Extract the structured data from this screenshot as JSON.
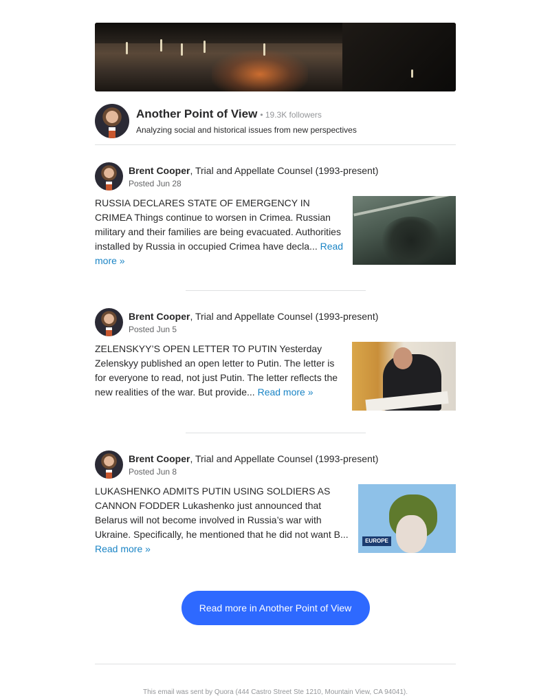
{
  "space": {
    "name": "Another Point of View",
    "followers": "• 19.3K followers",
    "description": "Analyzing social and historical issues from new perspectives"
  },
  "posts": [
    {
      "author": "Brent Cooper",
      "credential": ", Trial and Appellate Counsel (1993-present)",
      "date": "Posted Jun 28",
      "excerpt": "RUSSIA DECLARES STATE OF EMERGENCY IN CRIMEA Things continue to worsen in Crimea. Russian military and their families are being evacuated. Authorities installed by Russia in occupied Crimea have decla...",
      "read_more": "Read more »"
    },
    {
      "author": "Brent Cooper",
      "credential": ", Trial and Appellate Counsel (1993-present)",
      "date": "Posted Jun 5",
      "excerpt": "ZELENSKYY’S OPEN LETTER TO PUTIN Yesterday Zelenskyy published an open letter to Putin. The letter is for everyone to read, not just Putin. The letter reflects the new realities of the war. But provide...",
      "read_more": "Read more »"
    },
    {
      "author": "Brent Cooper",
      "credential": ", Trial and Appellate Counsel (1993-present)",
      "date": "Posted Jun 8",
      "excerpt": "LUKASHENKO ADMITS PUTIN USING SOLDIERS AS CANNON FODDER Lukashenko just announced that Belarus will not become involved in Russia’s war with Ukraine. Specifically, he mentioned that he did not want B...",
      "read_more": "Read more »",
      "image_sign": "EUROPE"
    }
  ],
  "cta": {
    "label": "Read more in Another Point of View"
  },
  "footer": {
    "text": "This email was sent by Quora (444 Castro Street Ste 1210, Mountain View, CA 94041)."
  }
}
